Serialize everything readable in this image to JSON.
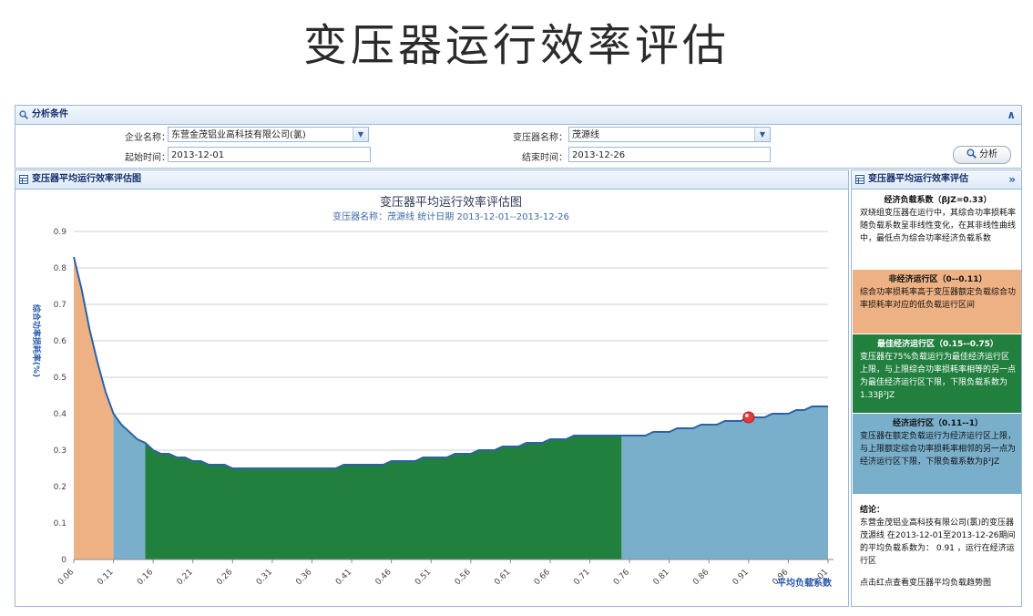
{
  "page_title": "变压器运行效率评估",
  "conditions": {
    "header": "分析条件",
    "company_label": "企业名称：",
    "company_value": "东营金茂铝业高科技有限公司(氯)",
    "transformer_label": "变压器名称：",
    "transformer_value": "茂源线",
    "start_label": "起始时间：",
    "start_value": "2013-12-01",
    "end_label": "结束时间：",
    "end_value": "2013-12-26",
    "analyze_button": "分析",
    "collapse_icon": "double-chevron-up-icon"
  },
  "chart_panel": {
    "header": "变压器平均运行效率评估图"
  },
  "chart_data": {
    "type": "area",
    "title": "变压器平均运行效率评估图",
    "subtitle": "变压器名称：茂源线  统计日期  2013-12-01--2013-12-26",
    "ylabel": "综合功率损耗率(%)",
    "xlabel": "平均负载系数",
    "ylim": [
      0,
      0.9
    ],
    "xlim": [
      0.06,
      1.01
    ],
    "yticks": [
      "0",
      "0.1",
      "0.2",
      "0.3",
      "0.4",
      "0.5",
      "0.6",
      "0.7",
      "0.8",
      "0.9"
    ],
    "xticks": [
      "0.06",
      "0.11",
      "0.16",
      "0.21",
      "0.26",
      "0.31",
      "0.36",
      "0.41",
      "0.46",
      "0.51",
      "0.56",
      "0.61",
      "0.66",
      "0.71",
      "0.76",
      "0.81",
      "0.86",
      "0.91",
      "0.96",
      "1.01"
    ],
    "x": [
      0.06,
      0.07,
      0.08,
      0.09,
      0.1,
      0.11,
      0.12,
      0.13,
      0.14,
      0.15,
      0.16,
      0.17,
      0.18,
      0.19,
      0.2,
      0.21,
      0.22,
      0.23,
      0.24,
      0.25,
      0.26,
      0.27,
      0.28,
      0.29,
      0.3,
      0.31,
      0.32,
      0.33,
      0.34,
      0.35,
      0.36,
      0.37,
      0.38,
      0.39,
      0.4,
      0.41,
      0.42,
      0.43,
      0.44,
      0.45,
      0.46,
      0.47,
      0.48,
      0.49,
      0.5,
      0.51,
      0.52,
      0.53,
      0.54,
      0.55,
      0.56,
      0.57,
      0.58,
      0.59,
      0.6,
      0.61,
      0.62,
      0.63,
      0.64,
      0.65,
      0.66,
      0.67,
      0.68,
      0.69,
      0.7,
      0.71,
      0.72,
      0.73,
      0.74,
      0.75,
      0.76,
      0.77,
      0.78,
      0.79,
      0.8,
      0.81,
      0.82,
      0.83,
      0.84,
      0.85,
      0.86,
      0.87,
      0.88,
      0.89,
      0.9,
      0.91,
      0.92,
      0.93,
      0.94,
      0.95,
      0.96,
      0.97,
      0.98,
      0.99,
      1.0,
      1.01
    ],
    "y": [
      0.83,
      0.74,
      0.63,
      0.54,
      0.46,
      0.4,
      0.37,
      0.35,
      0.33,
      0.32,
      0.3,
      0.29,
      0.29,
      0.28,
      0.28,
      0.27,
      0.27,
      0.26,
      0.26,
      0.26,
      0.25,
      0.25,
      0.25,
      0.25,
      0.25,
      0.25,
      0.25,
      0.25,
      0.25,
      0.25,
      0.25,
      0.25,
      0.25,
      0.25,
      0.26,
      0.26,
      0.26,
      0.26,
      0.26,
      0.26,
      0.27,
      0.27,
      0.27,
      0.27,
      0.28,
      0.28,
      0.28,
      0.28,
      0.29,
      0.29,
      0.29,
      0.3,
      0.3,
      0.3,
      0.31,
      0.31,
      0.31,
      0.32,
      0.32,
      0.32,
      0.33,
      0.33,
      0.33,
      0.34,
      0.34,
      0.34,
      0.34,
      0.34,
      0.34,
      0.34,
      0.34,
      0.34,
      0.34,
      0.35,
      0.35,
      0.35,
      0.36,
      0.36,
      0.36,
      0.37,
      0.37,
      0.37,
      0.38,
      0.38,
      0.38,
      0.39,
      0.39,
      0.39,
      0.4,
      0.4,
      0.4,
      0.41,
      0.41,
      0.42,
      0.42,
      0.42
    ],
    "regions": [
      {
        "name": "非经济运行区",
        "from": 0.06,
        "to": 0.11,
        "color": "#eeb184"
      },
      {
        "name": "经济运行区",
        "from": 0.11,
        "to": 0.15,
        "color": "#79afcb"
      },
      {
        "name": "最佳经济运行区",
        "from": 0.15,
        "to": 0.75,
        "color": "#22803f"
      },
      {
        "name": "经济运行区",
        "from": 0.75,
        "to": 1.01,
        "color": "#79afcb"
      }
    ],
    "marker": {
      "x": 0.91,
      "y": 0.39,
      "color": "#e23b3b"
    },
    "line_color": "#2d62a8",
    "grid": true,
    "legend": "none"
  },
  "side": {
    "header": "变压器平均运行效率评估",
    "collapse_icon": "double-chevron-right-icon",
    "s1_title": "经济负载系数（βJZ=0.33）",
    "s1_body": "双绕组变压器在运行中，其综合功率损耗率随负载系数呈非线性变化，在其非线性曲线中，最低点为综合功率经济负载系数",
    "s2_title": "非经济运行区（0--0.11）",
    "s2_body": "综合功率损耗率高于变压器额定负载综合功率损耗率对应的低负载运行区间",
    "s3_title": "最佳经济运行区（0.15--0.75）",
    "s3_body": "变压器在75%负载运行为最佳经济运行区上限，与上限综合功率损耗率相等的另一点为最佳经济运行区下限，下限负载系数为1.33β²JZ",
    "s4_title": "经济运行区（0.11--1）",
    "s4_body": "变压器在额定负载运行为经济运行区上限，与上限额定综合功率损耗率相邻的另一点为经济运行区下限，下限负载系数为β²JZ",
    "s5_title": "结论：",
    "s5_body": "东营金茂铝业高科技有限公司(氯)的变压器 茂源线 在2013-12-01至2013-12-26期间的平均负载系数为：  0.91  ，运行在经济运行区",
    "s5_hint": "点击红点查看变压器平均负载趋势图"
  }
}
